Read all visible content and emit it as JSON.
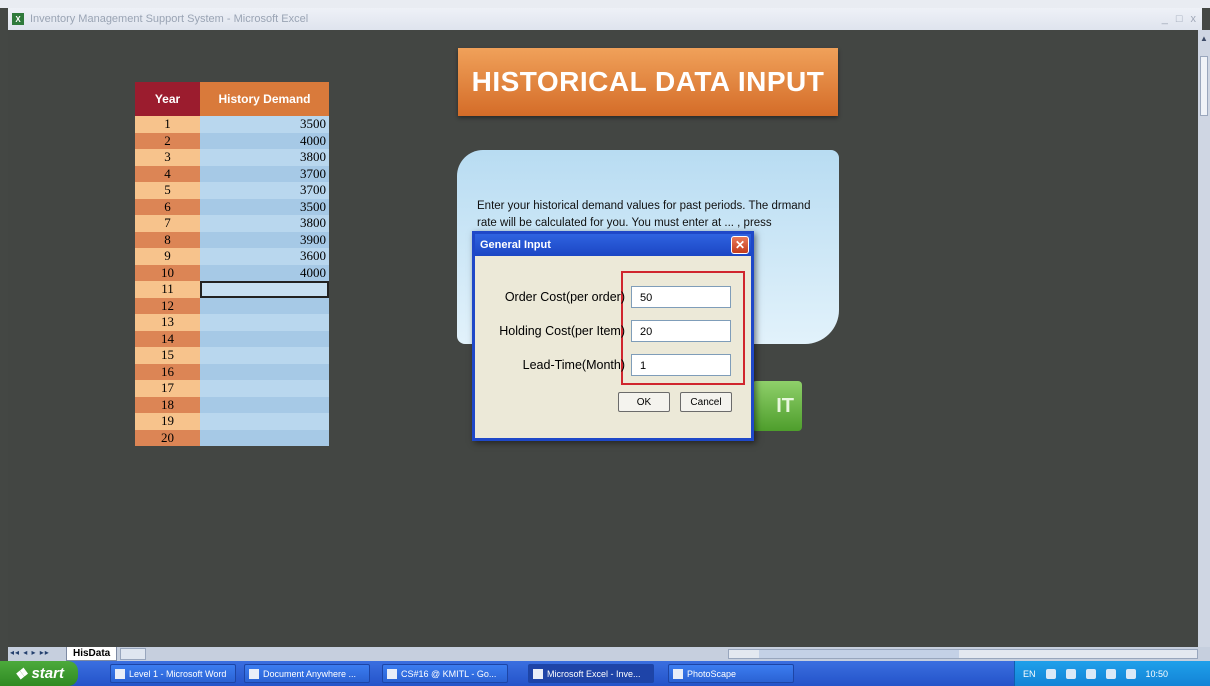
{
  "window": {
    "title": "Inventory Management Support System - Microsoft Excel",
    "controls": [
      "_",
      "□",
      "x"
    ]
  },
  "history": {
    "headers": [
      "Year",
      "History Demand"
    ],
    "rows": [
      {
        "year": "1",
        "demand": "3500"
      },
      {
        "year": "2",
        "demand": "4000"
      },
      {
        "year": "3",
        "demand": "3800"
      },
      {
        "year": "4",
        "demand": "3700"
      },
      {
        "year": "5",
        "demand": "3700"
      },
      {
        "year": "6",
        "demand": "3500"
      },
      {
        "year": "7",
        "demand": "3800"
      },
      {
        "year": "8",
        "demand": "3900"
      },
      {
        "year": "9",
        "demand": "3600"
      },
      {
        "year": "10",
        "demand": "4000"
      },
      {
        "year": "11",
        "demand": ""
      },
      {
        "year": "12",
        "demand": ""
      },
      {
        "year": "13",
        "demand": ""
      },
      {
        "year": "14",
        "demand": ""
      },
      {
        "year": "15",
        "demand": ""
      },
      {
        "year": "16",
        "demand": ""
      },
      {
        "year": "17",
        "demand": ""
      },
      {
        "year": "18",
        "demand": ""
      },
      {
        "year": "19",
        "demand": ""
      },
      {
        "year": "20",
        "demand": ""
      }
    ],
    "selected_row": "11"
  },
  "banner": {
    "title": "HISTORICAL DATA INPUT"
  },
  "info": {
    "text": "Enter your historical demand values for past periods. The drmand rate will be calculated for you. You must enter at ... , press"
  },
  "submit": {
    "label": "IT"
  },
  "dialog": {
    "title": "General Input",
    "close": "✕",
    "fields": {
      "order_cost": {
        "label": "Order Cost(per order)",
        "value": "50"
      },
      "holding_cost": {
        "label": "Holding Cost(per Item)",
        "value": "20"
      },
      "lead_time": {
        "label": "Lead-Time(Month)",
        "value": "1"
      }
    },
    "ok": "OK",
    "cancel": "Cancel"
  },
  "sheet_tabs": {
    "nav": "◂◂ ◂ ▸ ▸▸",
    "active": "HisData"
  },
  "taskbar": {
    "start": "start",
    "items": [
      "Level 1 - Microsoft Word",
      "Document Anywhere ...",
      "CS#16 @ KMITL - Go...",
      "Microsoft Excel - Inve...",
      "PhotoScape"
    ],
    "language": "EN",
    "clock": "10:50"
  }
}
